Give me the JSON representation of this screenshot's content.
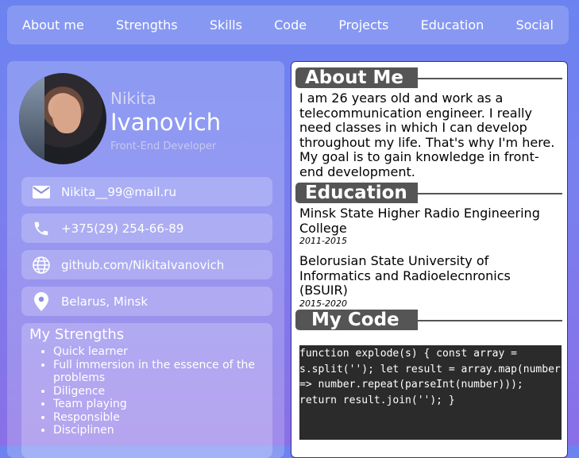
{
  "nav": {
    "items": [
      "About me",
      "Strengths",
      "Skills",
      "Code",
      "Projects",
      "Education",
      "Social"
    ]
  },
  "profile": {
    "first_name": "Nikita",
    "last_name": "Ivanovich",
    "role": "Front-End Developer"
  },
  "contacts": {
    "email": "Nikita__99@mail.ru",
    "phone": "+375(29) 254-66-89",
    "github": "github.com/NikitaIvanovich",
    "location": "Belarus, Minsk"
  },
  "strengths": {
    "title": "My Strengths",
    "items": [
      "Quick learner",
      "Full immersion in the essence of the problems",
      "Diligence",
      "Team playing",
      "Responsible",
      "Disciplinen"
    ]
  },
  "about": {
    "title": "About Me",
    "text": "I am 26 years old and work as a telecommunication engineer. I really need classes in which I can develop throughout my life. That's why I'm here. My goal is to gain knowledge in front-end development."
  },
  "education": {
    "title": "Education",
    "items": [
      {
        "name": "Minsk State Higher Radio Engineering College",
        "years": "2011-2015"
      },
      {
        "name": "Belorusian State University of Informatics and Radioelecnronics (BSUIR)",
        "years": "2015-2020"
      }
    ]
  },
  "code": {
    "title": "My Code",
    "snippet": "function explode(s) { const array = s.split(''); let result = array.map(number => number.repeat(parseInt(number))); return result.join(''); }"
  },
  "colors": {
    "accent": "#555555",
    "background_top": "#6b83f0",
    "background_bottom": "#8a6fe6"
  }
}
